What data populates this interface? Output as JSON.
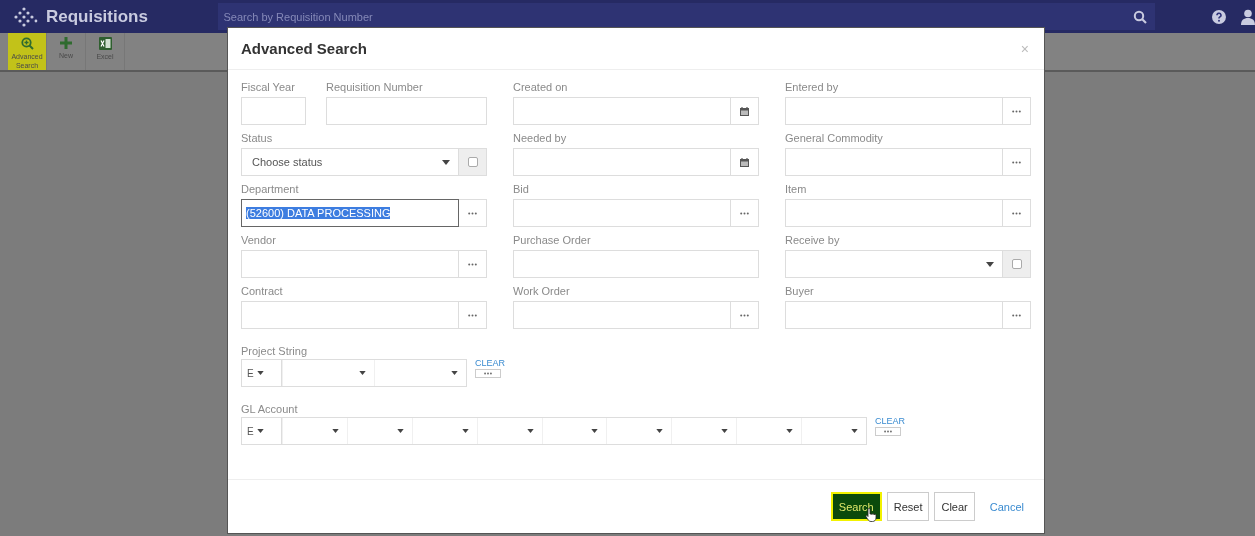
{
  "app_bar": {
    "title": "Requisitions",
    "search_placeholder": "Search by Requisition Number"
  },
  "toolbar": [
    {
      "kind": "advanced-search",
      "label": "Advanced Search",
      "selected": true
    },
    {
      "kind": "new",
      "label": "New",
      "selected": false
    },
    {
      "kind": "excel",
      "label": "Excel",
      "selected": false
    }
  ],
  "dialog": {
    "title": "Advanced Search",
    "close": "×",
    "rows": [
      [
        [
          {
            "label": "Fiscal Year",
            "kind": "text",
            "narrow": true
          },
          {
            "label": "Requisition Number",
            "kind": "text"
          }
        ],
        [
          {
            "label": "Created on",
            "kind": "date"
          }
        ],
        [
          {
            "label": "Entered by",
            "kind": "lookup"
          }
        ]
      ],
      [
        [
          {
            "label": "Status",
            "kind": "select",
            "placeholder": "Choose status",
            "checked": false
          }
        ],
        [
          {
            "label": "Needed by",
            "kind": "date"
          }
        ],
        [
          {
            "label": "General Commodity",
            "kind": "lookup"
          }
        ]
      ],
      [
        [
          {
            "label": "Department",
            "kind": "lookup",
            "value": "(52600) DATA PROCESSING",
            "focused": true
          }
        ],
        [
          {
            "label": "Bid",
            "kind": "lookup"
          }
        ],
        [
          {
            "label": "Item",
            "kind": "lookup"
          }
        ]
      ],
      [
        [
          {
            "label": "Vendor",
            "kind": "lookup"
          }
        ],
        [
          {
            "label": "Purchase Order",
            "kind": "text"
          }
        ],
        [
          {
            "label": "Receive by",
            "kind": "select",
            "checked": false
          }
        ]
      ],
      [
        [
          {
            "label": "Contract",
            "kind": "lookup"
          }
        ],
        [
          {
            "label": "Work Order",
            "kind": "lookup"
          }
        ],
        [
          {
            "label": "Buyer",
            "kind": "lookup"
          }
        ]
      ]
    ],
    "segment_strings": [
      {
        "label": "Project String",
        "prefix": "E",
        "clear": "CLEAR",
        "segments": [
          {
            "kind": "dropdown"
          },
          {
            "kind": "dropdown"
          }
        ]
      },
      {
        "label": "GL Account",
        "prefix": "E",
        "clear": "CLEAR",
        "segments": [
          {
            "kind": "dropdown"
          },
          {
            "kind": "dropdown"
          },
          {
            "kind": "dropdown"
          },
          {
            "kind": "dropdown"
          },
          {
            "kind": "dropdown"
          },
          {
            "kind": "dropdown"
          },
          {
            "kind": "dropdown"
          },
          {
            "kind": "dropdown"
          },
          {
            "kind": "dropdown"
          }
        ]
      }
    ],
    "buttons": [
      {
        "label": "Search",
        "kind": "primary"
      },
      {
        "label": "Reset",
        "kind": "default"
      },
      {
        "label": "Clear",
        "kind": "default"
      },
      {
        "label": "Cancel",
        "kind": "link"
      }
    ]
  }
}
